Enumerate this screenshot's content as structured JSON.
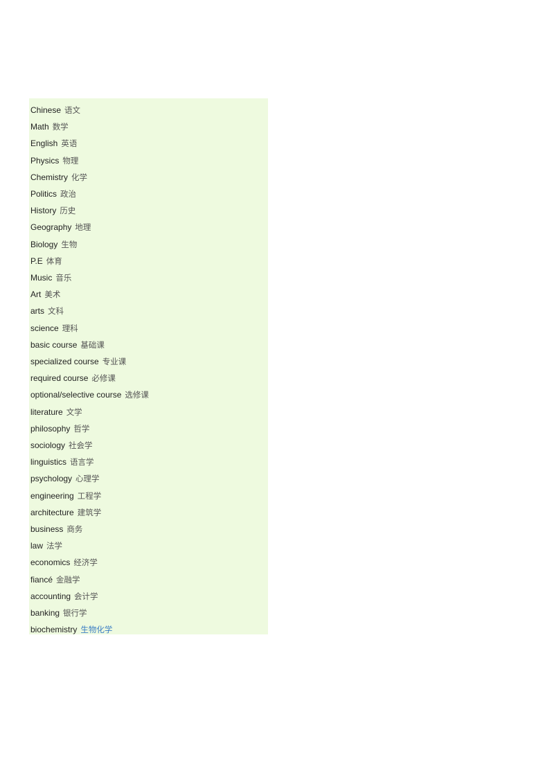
{
  "items": [
    {
      "en": "Chinese",
      "zh": "语文"
    },
    {
      "en": "Math",
      "zh": "数学"
    },
    {
      "en": "English",
      "zh": "英语"
    },
    {
      "en": "Physics",
      "zh": "物理"
    },
    {
      "en": "Chemistry",
      "zh": "化学"
    },
    {
      "en": "Politics",
      "zh": "政治"
    },
    {
      "en": "History",
      "zh": "历史"
    },
    {
      "en": "Geography",
      "zh": "地理"
    },
    {
      "en": "Biology",
      "zh": "生物"
    },
    {
      "en": "P.E",
      "zh": "体育"
    },
    {
      "en": "Music",
      "zh": "音乐"
    },
    {
      "en": "Art",
      "zh": "美术"
    },
    {
      "en": "arts",
      "zh": "文科"
    },
    {
      "en": "science",
      "zh": "理科"
    },
    {
      "en": "basic course",
      "zh": "基础课"
    },
    {
      "en": "specialized course",
      "zh": "专业课"
    },
    {
      "en": "required course",
      "zh": "必修课"
    },
    {
      "en": "optional/selective course",
      "zh": "选修课"
    },
    {
      "en": "literature",
      "zh": "文学"
    },
    {
      "en": "philosophy",
      "zh": "哲学"
    },
    {
      "en": "sociology",
      "zh": "社会学"
    },
    {
      "en": "linguistics",
      "zh": "语言学"
    },
    {
      "en": "psychology",
      "zh": "心理学"
    },
    {
      "en": "engineering",
      "zh": "工程学"
    },
    {
      "en": "architecture",
      "zh": "建筑学"
    },
    {
      "en": "business",
      "zh": "商务"
    },
    {
      "en": "law",
      "zh": "法学"
    },
    {
      "en": "economics",
      "zh": "经济学"
    },
    {
      "en": "fiancé",
      "zh": "金融学"
    },
    {
      "en": "accounting",
      "zh": "会计学"
    },
    {
      "en": "banking",
      "zh": "银行学"
    },
    {
      "en": "biochemistry",
      "zh": "生物化学",
      "link": true
    }
  ],
  "colors": {
    "background": "#eefadf",
    "link": "#3b7dc4"
  }
}
